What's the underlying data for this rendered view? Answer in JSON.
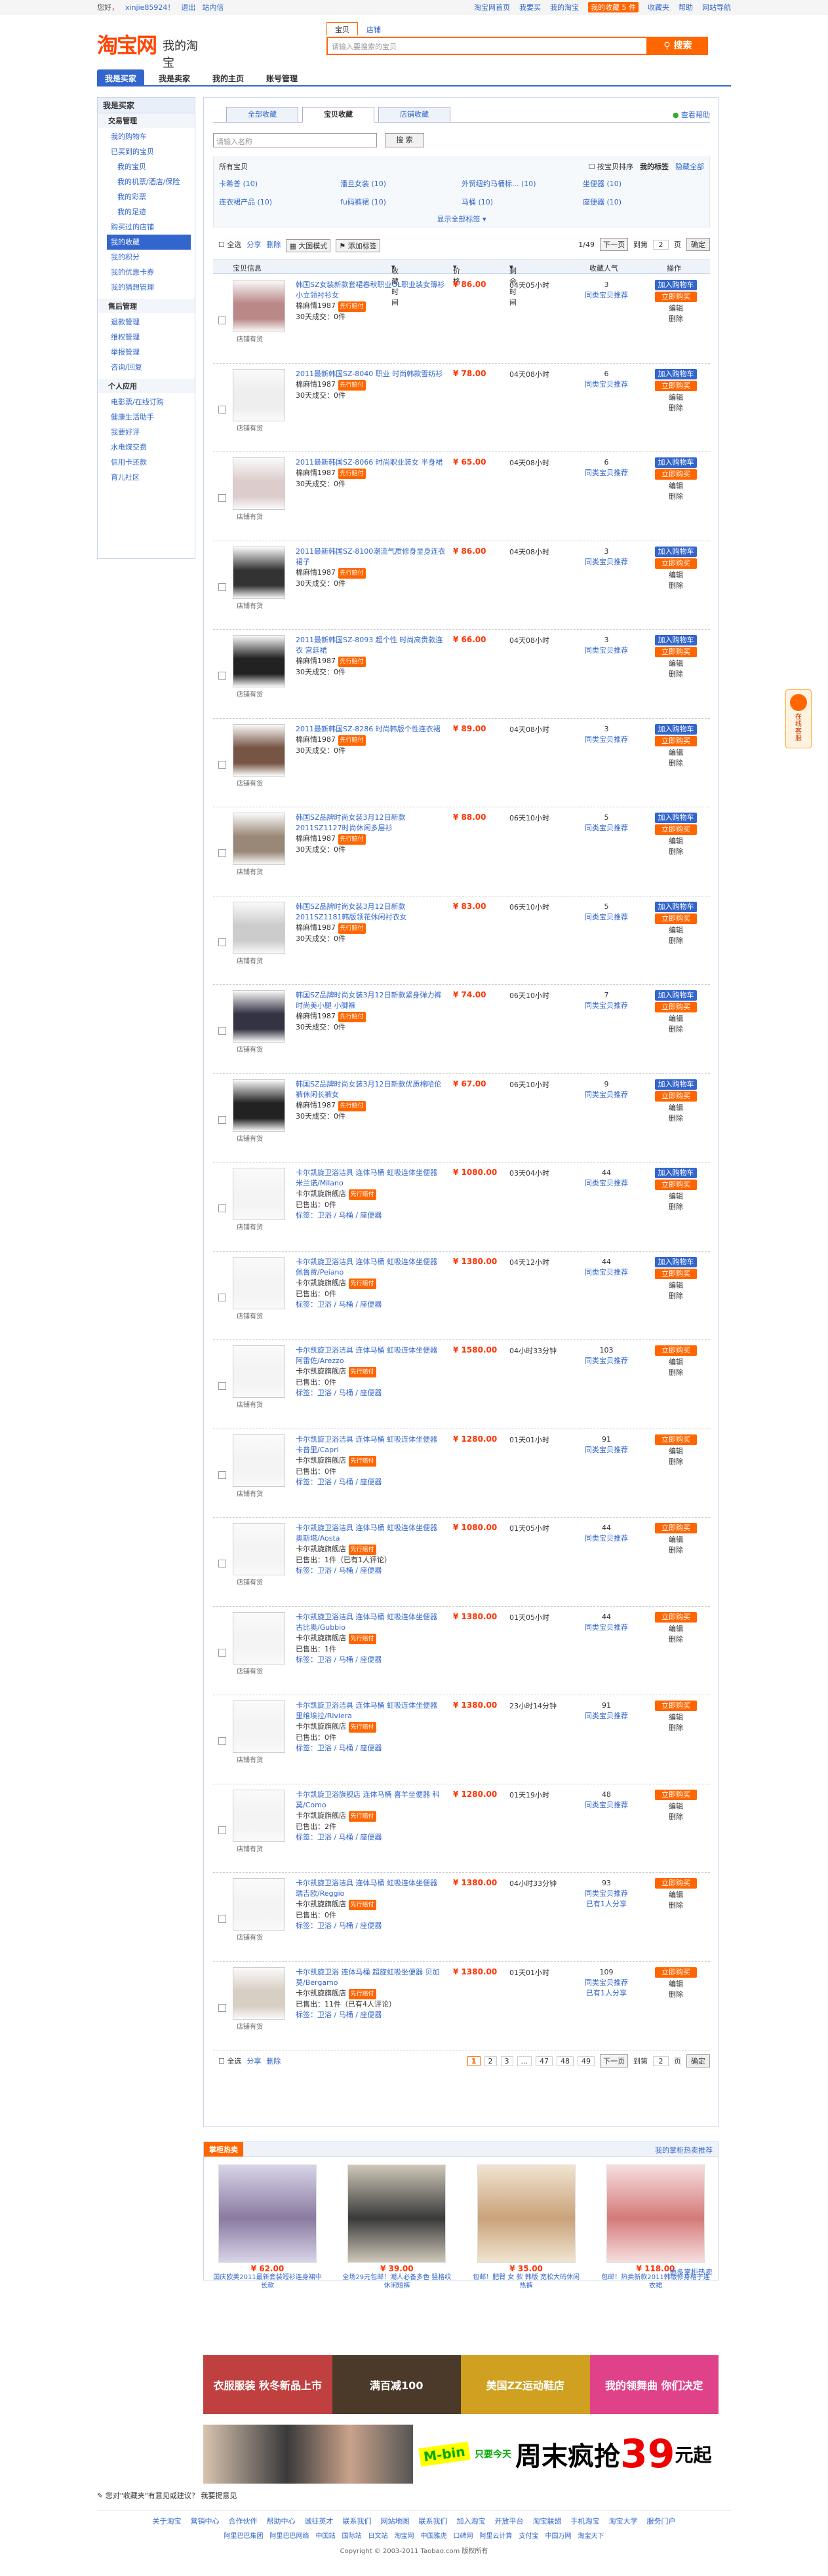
{
  "topbar": {
    "left": [
      "您好，",
      "xinjie85924！",
      "退出",
      "站内信"
    ],
    "right": [
      "淘宝网首页",
      "我要买",
      "我的淘宝",
      "我的收藏 5 件",
      "收藏夹",
      "帮助",
      "网站导航"
    ]
  },
  "header": {
    "logo": "淘宝网",
    "my": "我的淘宝",
    "search_tabs": [
      "宝贝",
      "店铺"
    ],
    "search_placeholder": "请输入要搜索的宝贝",
    "search_btn": "搜索"
  },
  "nav": [
    "我是买家",
    "我是卖家",
    "我的主页",
    "账号管理"
  ],
  "sidebar": {
    "title": "我是买家",
    "sections": [
      {
        "name": "交易管理",
        "items": [
          {
            "t": "我的购物车"
          },
          {
            "t": "已买到的宝贝",
            "in": false
          },
          {
            "t": "我的宝贝",
            "in": true
          },
          {
            "t": "我的机票/酒店/保险",
            "in": true
          },
          {
            "t": "我的彩票",
            "in": true
          },
          {
            "t": "我的足迹",
            "in": true
          },
          {
            "t": "购买过的店铺"
          },
          {
            "t": "我的收藏",
            "on": true
          },
          {
            "t": "我的积分"
          },
          {
            "t": "我的优惠卡券"
          },
          {
            "t": "我的猜想管理"
          }
        ]
      },
      {
        "name": "售后管理",
        "items": [
          {
            "t": "退款管理"
          },
          {
            "t": "维权管理"
          },
          {
            "t": "举报管理"
          },
          {
            "t": "咨询/回复"
          }
        ]
      },
      {
        "name": "个人应用",
        "items": [
          {
            "t": "电影票/在线订购"
          },
          {
            "t": "健康生活助手"
          },
          {
            "t": "我要好评"
          },
          {
            "t": "水电煤交费"
          },
          {
            "t": "信用卡还款"
          },
          {
            "t": "育儿社区"
          }
        ]
      }
    ]
  },
  "tabs": {
    "items": [
      "全部收藏",
      "宝贝收藏",
      "店铺收藏"
    ],
    "active": 1,
    "help": "查看帮助"
  },
  "filter": {
    "placeholder": "请输入名称",
    "btn": "搜 索"
  },
  "cats": {
    "head": "所有宝贝",
    "opts": [
      "按宝贝排序",
      "我的标签",
      "隐藏全部"
    ],
    "items": [
      "卡希普 (10)",
      "潘旦女装 (10)",
      "外贸纽约马桶标... (10)",
      "坐便器 (10)",
      "连衣裙产品 (10)",
      "fu码裤裙 (10)",
      "马桶 (10)",
      "座便器 (10)"
    ],
    "more": "显示全部标签"
  },
  "toolbar": {
    "select_all": "全选",
    "share": "分享",
    "del": "删除",
    "view": "大图模式",
    "tags": "添加标签",
    "page": "1/49",
    "next": "下一页",
    "goto": "到第",
    "page_num": "2",
    "page_unit": "页",
    "go": "确定"
  },
  "thead": [
    "宝贝信息",
    "收藏时间",
    "价格",
    "剩余时间",
    "收藏人气",
    "操作"
  ],
  "rows": [
    {
      "title": "韩国SZ女装新款套裙春秋职业OL职业装女簿衫小立领衬衫女",
      "seller": "棉麻情1987",
      "badge": "先行赔付",
      "sold": "30天成交：0件",
      "price": "¥ 86.00",
      "time": "04天05小时",
      "pop": "3",
      "op": "blue",
      "shop": "店铺有货",
      "color": "#b88"
    },
    {
      "title": "2011最新韩国SZ-8040 职业 时尚韩款雪纺衫",
      "seller": "棉麻情1987",
      "badge": "先行赔付",
      "sold": "30天成交：0件",
      "price": "¥ 78.00",
      "time": "04天08小时",
      "pop": "6",
      "op": "blue",
      "shop": "店铺有货",
      "color": "#eee"
    },
    {
      "title": "2011最新韩国SZ-8066 时尚职业装女 半身裙",
      "seller": "棉麻情1987",
      "badge": "先行赔付",
      "sold": "30天成交：0件",
      "price": "¥ 65.00",
      "time": "04天08小时",
      "pop": "6",
      "op": "blue",
      "shop": "店铺有货",
      "color": "#dcc"
    },
    {
      "title": "2011最新韩国SZ-8100潮流气质修身显身连衣裙子",
      "seller": "棉麻情1987",
      "badge": "先行赔付",
      "sold": "30天成交：0件",
      "price": "¥ 86.00",
      "time": "04天08小时",
      "pop": "3",
      "op": "blue",
      "shop": "店铺有货",
      "color": "#333"
    },
    {
      "title": "2011最新韩国SZ-8093 超个性 时尚高贵款连衣 宫廷裙",
      "seller": "棉麻情1987",
      "badge": "先行赔付",
      "sold": "30天成交：0件",
      "price": "¥ 66.00",
      "time": "04天08小时",
      "pop": "3",
      "op": "blue",
      "shop": "店铺有货",
      "color": "#222"
    },
    {
      "title": "2011最新韩国SZ-8286 时尚韩版个性连衣裙",
      "seller": "棉麻情1987",
      "badge": "先行赔付",
      "sold": "30天成交：0件",
      "price": "¥ 89.00",
      "time": "04天08小时",
      "pop": "3",
      "op": "blue",
      "shop": "店铺有货",
      "color": "#754"
    },
    {
      "title": "韩国SZ品牌时尚女装3月12日新款2011SZ1127时尚休闲多层衫",
      "seller": "棉麻情1987",
      "badge": "先行赔付",
      "sold": "30天成交：0件",
      "price": "¥ 88.00",
      "time": "06天10小时",
      "pop": "5",
      "op": "blue",
      "shop": "店铺有货",
      "color": "#987"
    },
    {
      "title": "韩国SZ品牌时尚女装3月12日新款2011SZ1181韩版领花休闲衬衣女",
      "seller": "棉麻情1987",
      "badge": "先行赔付",
      "sold": "30天成交：0件",
      "price": "¥ 83.00",
      "time": "06天10小时",
      "pop": "5",
      "op": "blue",
      "shop": "店铺有货",
      "color": "#ccc"
    },
    {
      "title": "韩国SZ品牌时尚女装3月12日新款紧身弹力裤 时尚美小腿 小脚裤",
      "seller": "棉麻情1987",
      "badge": "先行赔付",
      "sold": "30天成交：0件",
      "price": "¥ 74.00",
      "time": "06天10小时",
      "pop": "7",
      "op": "blue",
      "shop": "店铺有货",
      "color": "#334"
    },
    {
      "title": "韩国SZ品牌时尚女装3月12日新款优质棉哈伦裤休闲长裤女",
      "seller": "棉麻情1987",
      "badge": "先行赔付",
      "sold": "30天成交：0件",
      "price": "¥ 67.00",
      "time": "06天10小时",
      "pop": "9",
      "op": "blue",
      "shop": "店铺有货",
      "color": "#222"
    },
    {
      "title": "卡尔凯旋卫浴洁具 连体马桶 虹吸连体坐便器 米兰诺/Milano",
      "seller": "卡尔凯旋旗舰店",
      "badge": "先行赔付",
      "sold": "已售出：0件",
      "price": "¥ 1080.00",
      "time": "03天04小时",
      "pop": "44",
      "op": "blue",
      "shop": "店铺有货",
      "color": "#f4f4f4",
      "tags": "标签：卫浴 / 马桶 / 座便器"
    },
    {
      "title": "卡尔凯旋卫浴洁具 连体马桶 虹吸连体坐便器 佩鲁贾/Peiano",
      "seller": "卡尔凯旋旗舰店",
      "badge": "先行赔付",
      "sold": "已售出：0件",
      "price": "¥ 1380.00",
      "time": "04天12小时",
      "pop": "44",
      "op": "blue",
      "shop": "店铺有货",
      "color": "#f4f4f4",
      "tags": "标签：卫浴 / 马桶 / 座便器"
    },
    {
      "title": "卡尔凯旋卫浴洁具 连体马桶 虹吸连体坐便器 阿雷佐/Arezzo",
      "seller": "卡尔凯旋旗舰店",
      "badge": "先行赔付",
      "sold": "已售出：0件",
      "price": "¥ 1580.00",
      "time": "04小时33分钟",
      "pop": "103",
      "op": "orange",
      "shop": "店铺有货",
      "color": "#f4f4f4",
      "tags": "标签：卫浴 / 马桶 / 座便器"
    },
    {
      "title": "卡尔凯旋卫浴洁具 连体马桶 虹吸连体坐便器 卡普里/Capri",
      "seller": "卡尔凯旋旗舰店",
      "badge": "先行赔付",
      "sold": "已售出：0件",
      "price": "¥ 1280.00",
      "time": "01天01小时",
      "pop": "91",
      "op": "orange",
      "shop": "店铺有货",
      "color": "#f4f4f4",
      "tags": "标签：卫浴 / 马桶 / 座便器"
    },
    {
      "title": "卡尔凯旋卫浴洁具 连体马桶 虹吸连体坐便器 奥斯塔/Aosta",
      "seller": "卡尔凯旋旗舰店",
      "badge": "先行赔付",
      "sold": "已售出：1件（已有1人评论）",
      "price": "¥ 1080.00",
      "time": "01天05小时",
      "pop": "44",
      "op": "orange",
      "shop": "店铺有货",
      "color": "#f4f4f4",
      "tags": "标签：卫浴 / 马桶 / 座便器"
    },
    {
      "title": "卡尔凯旋卫浴洁具 连体马桶 虹吸连体坐便器 古比奥/Gubbio",
      "seller": "卡尔凯旋旗舰店",
      "badge": "先行赔付",
      "sold": "已售出：1件",
      "price": "¥ 1380.00",
      "time": "01天05小时",
      "pop": "44",
      "op": "orange",
      "shop": "店铺有货",
      "color": "#f4f4f4",
      "tags": "标签：卫浴 / 马桶 / 座便器"
    },
    {
      "title": "卡尔凯旋卫浴洁具 连体马桶 虹吸连体坐便器 里维埃拉/Riviera",
      "seller": "卡尔凯旋旗舰店",
      "badge": "先行赔付",
      "sold": "已售出：0件",
      "price": "¥ 1380.00",
      "time": "23小时14分钟",
      "pop": "91",
      "op": "orange",
      "shop": "店铺有货",
      "color": "#f4f4f4",
      "tags": "标签：卫浴 / 马桶 / 座便器"
    },
    {
      "title": "卡尔凯旋卫浴旗舰店 连体马桶 喜羊坐便器 科莫/Como",
      "seller": "卡尔凯旋旗舰店",
      "badge": "先行赔付",
      "sold": "已售出：2件",
      "price": "¥ 1280.00",
      "time": "01天19小时",
      "pop": "48",
      "op": "orange",
      "shop": "店铺有货",
      "color": "#f4f4f4",
      "tags": "标签：卫浴 / 马桶 / 座便器"
    },
    {
      "title": "卡尔凯旋卫浴洁具 连体马桶 虹吸连体坐便器 瑞吉欧/Reggio",
      "seller": "卡尔凯旋旗舰店",
      "badge": "先行赔付",
      "sold": "已售出：0件",
      "price": "¥ 1380.00",
      "time": "04小时33分钟",
      "pop": "93",
      "op": "orange",
      "shop": "店铺有货",
      "color": "#f4f4f4",
      "tags": "标签：卫浴 / 马桶 / 座便器",
      "bought": "已有1人分享"
    },
    {
      "title": "卡尔凯旋卫浴 连体马桶 超旋虹吸坐便器 贝加莫/Bergamo",
      "seller": "卡尔凯旋旗舰店",
      "badge": "先行赔付",
      "sold": "已售出：11件（已有4人评论）",
      "price": "¥ 1380.00",
      "time": "01天01小时",
      "pop": "109",
      "op": "orange",
      "shop": "店铺有货",
      "color": "#d8cfc4",
      "tags": "标签：卫浴 / 马桶 / 座便器",
      "bought": "已有1人分享"
    }
  ],
  "row_labels": {
    "pop_link": "同类宝贝推荐",
    "blue": "加入购物车",
    "orange": "立即购买",
    "sub_blue": "立即购买",
    "edit": "编辑",
    "del": "删除"
  },
  "bottom_pages": [
    "1",
    "2",
    "3",
    "...",
    "47",
    "48",
    "49"
  ],
  "rec": {
    "title": "掌柜热卖",
    "more_top": "我的掌柜热卖推荐",
    "more_bottom": "更多掌柜热卖",
    "items": [
      {
        "price": "¥ 62.00",
        "desc": "国庆欧美2011最新套装短衫连身裙中长款",
        "c1": "#8a7aa0",
        "c2": "#d8d4e8"
      },
      {
        "price": "¥ 39.00",
        "desc": "全场29元包邮！潮人必备多色 竖格纹休闲短裤",
        "c1": "#3a3a3a",
        "c2": "#cfc7b8"
      },
      {
        "price": "¥ 35.00",
        "desc": "包邮！肥臀 女 款 韩版 宽松大码休闲 热裤",
        "c1": "#caa27a",
        "c2": "#f0e4d0"
      },
      {
        "price": "¥ 118.00",
        "desc": "包邮！热卖新款2011韩版修身格子连衣裙",
        "c1": "#d47a7a",
        "c2": "#f6dede"
      }
    ]
  },
  "banners": [
    {
      "text": "衣服服装 秋冬新品上市",
      "color": "#c04040"
    },
    {
      "text": "满百减100",
      "color": "#4b3a2a"
    },
    {
      "text": "美国ZZ运动鞋店",
      "color": "#d0a020"
    },
    {
      "text": "我的领舞曲 你们决定",
      "color": "#e0428a"
    }
  ],
  "ban2": {
    "mn": "M-bin",
    "big": "周末疯抢",
    "num": "39",
    "yuan": "元起",
    "sub": "只要今天"
  },
  "tip": "您对\"收藏夹\"有意见或建议？ 我要提意见",
  "footer": {
    "links": [
      "关于淘宝",
      "营销中心",
      "合作伙伴",
      "帮助中心",
      "诚征英才",
      "联系我们",
      "网站地图",
      "联系我们",
      "加入淘宝",
      "开放平台",
      "淘宝联盟",
      "手机淘宝",
      "淘宝大学",
      "服务门户"
    ],
    "links2": [
      "阿里巴巴集团",
      "阿里巴巴网络",
      "中国站",
      "国际站",
      "日文站",
      "淘宝网",
      "中国雅虎",
      "口碑网",
      "阿里云计算",
      "支付宝",
      "中国万网",
      "淘宝天下"
    ],
    "cp": "Copyright © 2003-2011 Taobao.com 版权所有"
  },
  "float": "在线客服",
  "colors": {
    "accent": "#3366cc",
    "orange": "#ff6600",
    "price": "#ff3300"
  }
}
